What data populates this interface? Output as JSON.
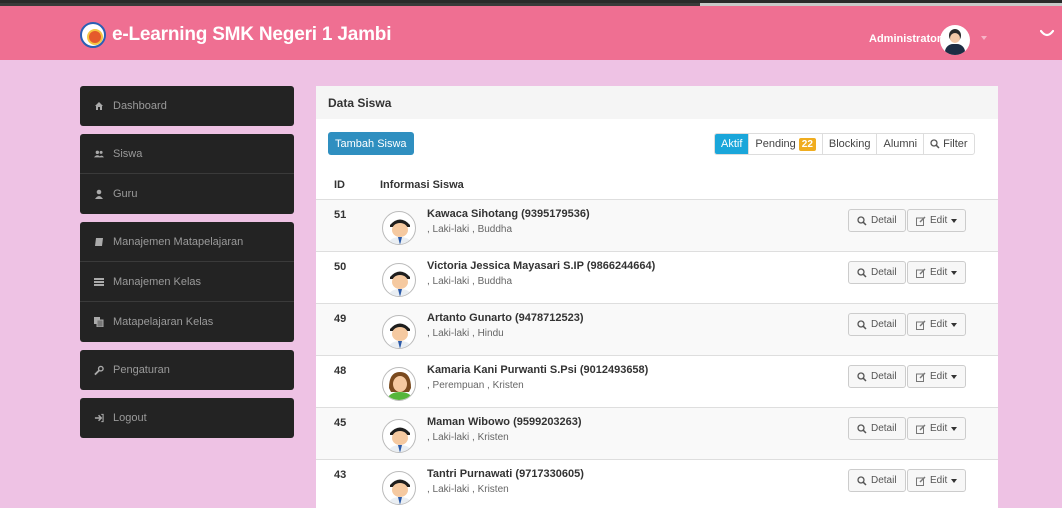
{
  "header": {
    "title": "e-Learning SMK Negeri 1 Jambi",
    "user": "Administrator",
    "icons": [
      "school-logo-icon",
      "user-avatar-icon",
      "collapse-icon"
    ]
  },
  "sidebar": {
    "groups": [
      [
        {
          "label": "Dashboard",
          "icon": "home-icon"
        }
      ],
      [
        {
          "label": "Siswa",
          "icon": "users-icon"
        },
        {
          "label": "Guru",
          "icon": "user-icon"
        }
      ],
      [
        {
          "label": "Manajemen Matapelajaran",
          "icon": "book-icon"
        },
        {
          "label": "Manajemen Kelas",
          "icon": "list-icon"
        },
        {
          "label": "Matapelajaran Kelas",
          "icon": "copy-icon"
        }
      ],
      [
        {
          "label": "Pengaturan",
          "icon": "wrench-icon"
        }
      ],
      [
        {
          "label": "Logout",
          "icon": "logout-icon"
        }
      ]
    ]
  },
  "main": {
    "title": "Data Siswa",
    "add_button": "Tambah Siswa",
    "filters": {
      "aktif": "Aktif",
      "pending": "Pending",
      "pending_count": "22",
      "blocking": "Blocking",
      "alumni": "Alumni",
      "filter": "Filter"
    },
    "columns": {
      "id": "ID",
      "info": "Informasi Siswa"
    },
    "detail_label": "Detail",
    "edit_label": "Edit",
    "rows": [
      {
        "id": "51",
        "name": "Kawaca Sihotang (9395179536)",
        "info": ", Laki-laki , Buddha",
        "avatar": "male-avatar"
      },
      {
        "id": "50",
        "name": "Victoria Jessica Mayasari S.IP (9866244664)",
        "info": ", Laki-laki , Buddha",
        "avatar": "male-avatar"
      },
      {
        "id": "49",
        "name": "Artanto Gunarto (9478712523)",
        "info": ", Laki-laki , Hindu",
        "avatar": "male-avatar"
      },
      {
        "id": "48",
        "name": "Kamaria Kani Purwanti S.Psi (9012493658)",
        "info": ", Perempuan , Kristen",
        "avatar": "female-avatar"
      },
      {
        "id": "45",
        "name": "Maman Wibowo (9599203263)",
        "info": ", Laki-laki , Kristen",
        "avatar": "male-avatar"
      },
      {
        "id": "43",
        "name": "Tantri Purnawati (9717330605)",
        "info": ", Laki-laki , Kristen",
        "avatar": "male-avatar"
      }
    ]
  },
  "colors": {
    "topbar": "#ef6f92",
    "background": "#eec2e4",
    "sidebar": "#232323",
    "primary": "#2f8fc0",
    "active_filter": "#1aa6da",
    "badge": "#f0ad1f"
  }
}
